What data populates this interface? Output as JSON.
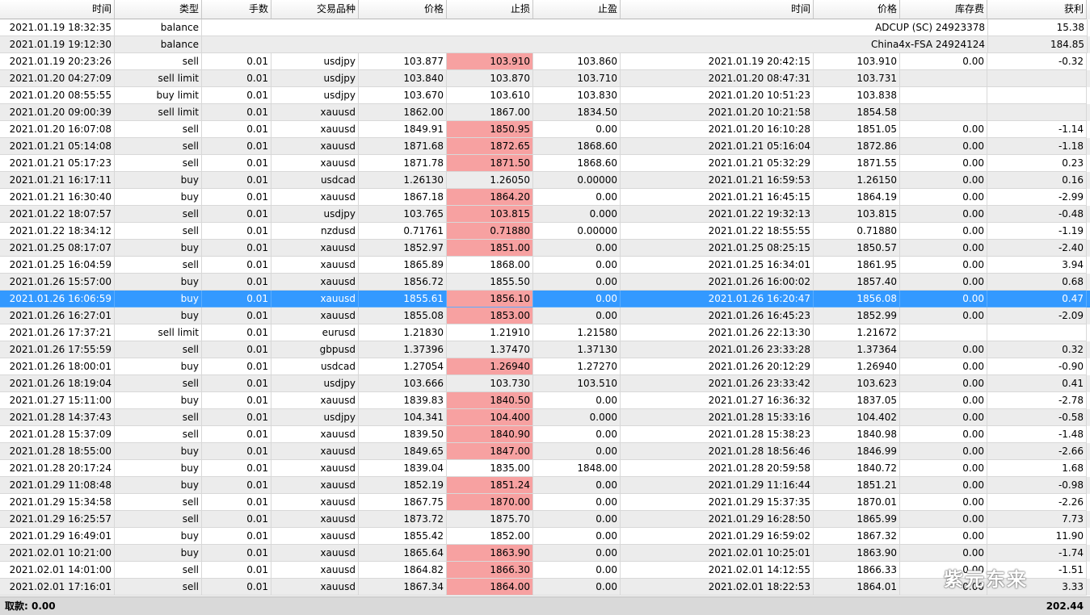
{
  "columns": [
    "时间",
    "类型",
    "手数",
    "交易品种",
    "价格",
    "止损",
    "止盈",
    "时间",
    "价格",
    "库存费",
    "获利"
  ],
  "sort_indicator": "/",
  "balance_rows": [
    {
      "time": "2021.01.19 18:32:35",
      "type": "balance",
      "comment": "ADCUP (SC) 24923378",
      "profit": "15.38"
    },
    {
      "time": "2021.01.19 19:12:30",
      "type": "balance",
      "comment": "China4x-FSA 24924124",
      "profit": "184.85"
    }
  ],
  "trades": [
    {
      "open_time": "2021.01.19 20:23:26",
      "type": "sell",
      "lots": "0.01",
      "symbol": "usdjpy",
      "open_price": "103.877",
      "sl": "103.910",
      "sl_hit": true,
      "tp": "103.860",
      "close_time": "2021.01.19 20:42:15",
      "close_price": "103.910",
      "swap": "0.00",
      "profit": "-0.32"
    },
    {
      "open_time": "2021.01.20 04:27:09",
      "type": "sell limit",
      "lots": "0.01",
      "symbol": "usdjpy",
      "open_price": "103.840",
      "sl": "103.870",
      "sl_hit": false,
      "tp": "103.710",
      "close_time": "2021.01.20 08:47:31",
      "close_price": "103.731",
      "swap": "",
      "profit": ""
    },
    {
      "open_time": "2021.01.20 08:55:55",
      "type": "buy limit",
      "lots": "0.01",
      "symbol": "usdjpy",
      "open_price": "103.670",
      "sl": "103.610",
      "sl_hit": false,
      "tp": "103.830",
      "close_time": "2021.01.20 10:51:23",
      "close_price": "103.838",
      "swap": "",
      "profit": ""
    },
    {
      "open_time": "2021.01.20 09:00:39",
      "type": "sell limit",
      "lots": "0.01",
      "symbol": "xauusd",
      "open_price": "1862.00",
      "sl": "1867.00",
      "sl_hit": false,
      "tp": "1834.50",
      "close_time": "2021.01.20 10:21:58",
      "close_price": "1854.58",
      "swap": "",
      "profit": ""
    },
    {
      "open_time": "2021.01.20 16:07:08",
      "type": "sell",
      "lots": "0.01",
      "symbol": "xauusd",
      "open_price": "1849.91",
      "sl": "1850.95",
      "sl_hit": true,
      "tp": "0.00",
      "close_time": "2021.01.20 16:10:28",
      "close_price": "1851.05",
      "swap": "0.00",
      "profit": "-1.14"
    },
    {
      "open_time": "2021.01.21 05:14:08",
      "type": "sell",
      "lots": "0.01",
      "symbol": "xauusd",
      "open_price": "1871.68",
      "sl": "1872.65",
      "sl_hit": true,
      "tp": "1868.60",
      "close_time": "2021.01.21 05:16:04",
      "close_price": "1872.86",
      "swap": "0.00",
      "profit": "-1.18"
    },
    {
      "open_time": "2021.01.21 05:17:23",
      "type": "sell",
      "lots": "0.01",
      "symbol": "xauusd",
      "open_price": "1871.78",
      "sl": "1871.50",
      "sl_hit": true,
      "tp": "1868.60",
      "close_time": "2021.01.21 05:32:29",
      "close_price": "1871.55",
      "swap": "0.00",
      "profit": "0.23"
    },
    {
      "open_time": "2021.01.21 16:17:11",
      "type": "buy",
      "lots": "0.01",
      "symbol": "usdcad",
      "open_price": "1.26130",
      "sl": "1.26050",
      "sl_hit": false,
      "tp": "0.00000",
      "close_time": "2021.01.21 16:59:53",
      "close_price": "1.26150",
      "swap": "0.00",
      "profit": "0.16"
    },
    {
      "open_time": "2021.01.21 16:30:40",
      "type": "buy",
      "lots": "0.01",
      "symbol": "xauusd",
      "open_price": "1867.18",
      "sl": "1864.20",
      "sl_hit": true,
      "tp": "0.00",
      "close_time": "2021.01.21 16:45:15",
      "close_price": "1864.19",
      "swap": "0.00",
      "profit": "-2.99"
    },
    {
      "open_time": "2021.01.22 18:07:57",
      "type": "sell",
      "lots": "0.01",
      "symbol": "usdjpy",
      "open_price": "103.765",
      "sl": "103.815",
      "sl_hit": true,
      "tp": "0.000",
      "close_time": "2021.01.22 19:32:13",
      "close_price": "103.815",
      "swap": "0.00",
      "profit": "-0.48"
    },
    {
      "open_time": "2021.01.22 18:34:12",
      "type": "sell",
      "lots": "0.01",
      "symbol": "nzdusd",
      "open_price": "0.71761",
      "sl": "0.71880",
      "sl_hit": true,
      "tp": "0.00000",
      "close_time": "2021.01.22 18:55:55",
      "close_price": "0.71880",
      "swap": "0.00",
      "profit": "-1.19"
    },
    {
      "open_time": "2021.01.25 08:17:07",
      "type": "buy",
      "lots": "0.01",
      "symbol": "xauusd",
      "open_price": "1852.97",
      "sl": "1851.00",
      "sl_hit": true,
      "tp": "0.00",
      "close_time": "2021.01.25 08:25:15",
      "close_price": "1850.57",
      "swap": "0.00",
      "profit": "-2.40"
    },
    {
      "open_time": "2021.01.25 16:04:59",
      "type": "sell",
      "lots": "0.01",
      "symbol": "xauusd",
      "open_price": "1865.89",
      "sl": "1868.00",
      "sl_hit": false,
      "tp": "0.00",
      "close_time": "2021.01.25 16:34:01",
      "close_price": "1861.95",
      "swap": "0.00",
      "profit": "3.94"
    },
    {
      "open_time": "2021.01.26 15:57:00",
      "type": "buy",
      "lots": "0.01",
      "symbol": "xauusd",
      "open_price": "1856.72",
      "sl": "1855.50",
      "sl_hit": false,
      "tp": "0.00",
      "close_time": "2021.01.26 16:00:02",
      "close_price": "1857.40",
      "swap": "0.00",
      "profit": "0.68"
    },
    {
      "open_time": "2021.01.26 16:06:59",
      "type": "buy",
      "lots": "0.01",
      "symbol": "xauusd",
      "open_price": "1855.61",
      "sl": "1856.10",
      "sl_hit": true,
      "tp": "0.00",
      "close_time": "2021.01.26 16:20:47",
      "close_price": "1856.08",
      "swap": "0.00",
      "profit": "0.47",
      "selected": true
    },
    {
      "open_time": "2021.01.26 16:27:01",
      "type": "buy",
      "lots": "0.01",
      "symbol": "xauusd",
      "open_price": "1855.08",
      "sl": "1853.00",
      "sl_hit": true,
      "tp": "0.00",
      "close_time": "2021.01.26 16:45:23",
      "close_price": "1852.99",
      "swap": "0.00",
      "profit": "-2.09"
    },
    {
      "open_time": "2021.01.26 17:37:21",
      "type": "sell limit",
      "lots": "0.01",
      "symbol": "eurusd",
      "open_price": "1.21830",
      "sl": "1.21910",
      "sl_hit": false,
      "tp": "1.21580",
      "close_time": "2021.01.26 22:13:30",
      "close_price": "1.21672",
      "swap": "",
      "profit": ""
    },
    {
      "open_time": "2021.01.26 17:55:59",
      "type": "sell",
      "lots": "0.01",
      "symbol": "gbpusd",
      "open_price": "1.37396",
      "sl": "1.37470",
      "sl_hit": false,
      "tp": "1.37130",
      "close_time": "2021.01.26 23:33:28",
      "close_price": "1.37364",
      "swap": "0.00",
      "profit": "0.32"
    },
    {
      "open_time": "2021.01.26 18:00:01",
      "type": "buy",
      "lots": "0.01",
      "symbol": "usdcad",
      "open_price": "1.27054",
      "sl": "1.26940",
      "sl_hit": true,
      "tp": "1.27270",
      "close_time": "2021.01.26 20:12:29",
      "close_price": "1.26940",
      "swap": "0.00",
      "profit": "-0.90"
    },
    {
      "open_time": "2021.01.26 18:19:04",
      "type": "sell",
      "lots": "0.01",
      "symbol": "usdjpy",
      "open_price": "103.666",
      "sl": "103.730",
      "sl_hit": false,
      "tp": "103.510",
      "close_time": "2021.01.26 23:33:42",
      "close_price": "103.623",
      "swap": "0.00",
      "profit": "0.41"
    },
    {
      "open_time": "2021.01.27 15:11:00",
      "type": "buy",
      "lots": "0.01",
      "symbol": "xauusd",
      "open_price": "1839.83",
      "sl": "1840.50",
      "sl_hit": true,
      "tp": "0.00",
      "close_time": "2021.01.27 16:36:32",
      "close_price": "1837.05",
      "swap": "0.00",
      "profit": "-2.78"
    },
    {
      "open_time": "2021.01.28 14:37:43",
      "type": "sell",
      "lots": "0.01",
      "symbol": "usdjpy",
      "open_price": "104.341",
      "sl": "104.400",
      "sl_hit": true,
      "tp": "0.000",
      "close_time": "2021.01.28 15:33:16",
      "close_price": "104.402",
      "swap": "0.00",
      "profit": "-0.58"
    },
    {
      "open_time": "2021.01.28 15:37:09",
      "type": "sell",
      "lots": "0.01",
      "symbol": "xauusd",
      "open_price": "1839.50",
      "sl": "1840.90",
      "sl_hit": true,
      "tp": "0.00",
      "close_time": "2021.01.28 15:38:23",
      "close_price": "1840.98",
      "swap": "0.00",
      "profit": "-1.48"
    },
    {
      "open_time": "2021.01.28 18:55:00",
      "type": "buy",
      "lots": "0.01",
      "symbol": "xauusd",
      "open_price": "1849.65",
      "sl": "1847.00",
      "sl_hit": true,
      "tp": "0.00",
      "close_time": "2021.01.28 18:56:46",
      "close_price": "1846.99",
      "swap": "0.00",
      "profit": "-2.66"
    },
    {
      "open_time": "2021.01.28 20:17:24",
      "type": "buy",
      "lots": "0.01",
      "symbol": "xauusd",
      "open_price": "1839.04",
      "sl": "1835.00",
      "sl_hit": false,
      "tp": "1848.00",
      "close_time": "2021.01.28 20:59:58",
      "close_price": "1840.72",
      "swap": "0.00",
      "profit": "1.68"
    },
    {
      "open_time": "2021.01.29 11:08:48",
      "type": "buy",
      "lots": "0.01",
      "symbol": "xauusd",
      "open_price": "1852.19",
      "sl": "1851.24",
      "sl_hit": true,
      "tp": "0.00",
      "close_time": "2021.01.29 11:16:44",
      "close_price": "1851.21",
      "swap": "0.00",
      "profit": "-0.98"
    },
    {
      "open_time": "2021.01.29 15:34:58",
      "type": "sell",
      "lots": "0.01",
      "symbol": "xauusd",
      "open_price": "1867.75",
      "sl": "1870.00",
      "sl_hit": true,
      "tp": "0.00",
      "close_time": "2021.01.29 15:37:35",
      "close_price": "1870.01",
      "swap": "0.00",
      "profit": "-2.26"
    },
    {
      "open_time": "2021.01.29 16:25:57",
      "type": "sell",
      "lots": "0.01",
      "symbol": "xauusd",
      "open_price": "1873.72",
      "sl": "1875.70",
      "sl_hit": false,
      "tp": "0.00",
      "close_time": "2021.01.29 16:28:50",
      "close_price": "1865.99",
      "swap": "0.00",
      "profit": "7.73"
    },
    {
      "open_time": "2021.01.29 16:49:01",
      "type": "buy",
      "lots": "0.01",
      "symbol": "xauusd",
      "open_price": "1855.42",
      "sl": "1852.00",
      "sl_hit": false,
      "tp": "0.00",
      "close_time": "2021.01.29 16:59:02",
      "close_price": "1867.32",
      "swap": "0.00",
      "profit": "11.90"
    },
    {
      "open_time": "2021.02.01 10:21:00",
      "type": "buy",
      "lots": "0.01",
      "symbol": "xauusd",
      "open_price": "1865.64",
      "sl": "1863.90",
      "sl_hit": true,
      "tp": "0.00",
      "close_time": "2021.02.01 10:25:01",
      "close_price": "1863.90",
      "swap": "0.00",
      "profit": "-1.74"
    },
    {
      "open_time": "2021.02.01 14:01:00",
      "type": "sell",
      "lots": "0.01",
      "symbol": "xauusd",
      "open_price": "1864.82",
      "sl": "1866.30",
      "sl_hit": true,
      "tp": "0.00",
      "close_time": "2021.02.01 14:12:55",
      "close_price": "1866.33",
      "swap": "0.00",
      "profit": "-1.51"
    },
    {
      "open_time": "2021.02.01 17:16:01",
      "type": "sell",
      "lots": "0.01",
      "symbol": "xauusd",
      "open_price": "1867.34",
      "sl": "1864.00",
      "sl_hit": true,
      "tp": "0.00",
      "close_time": "2021.02.01 18:22:53",
      "close_price": "1864.01",
      "swap": "0.00",
      "profit": "3.33"
    }
  ],
  "footer": {
    "withdrawal": "取款: 0.00",
    "total": "202.44"
  },
  "watermark": "紫元东来",
  "colors": {
    "selected_row": "#3399ff",
    "stop_loss_highlight": "#f7a1a1",
    "alt_row": "#ececec"
  }
}
